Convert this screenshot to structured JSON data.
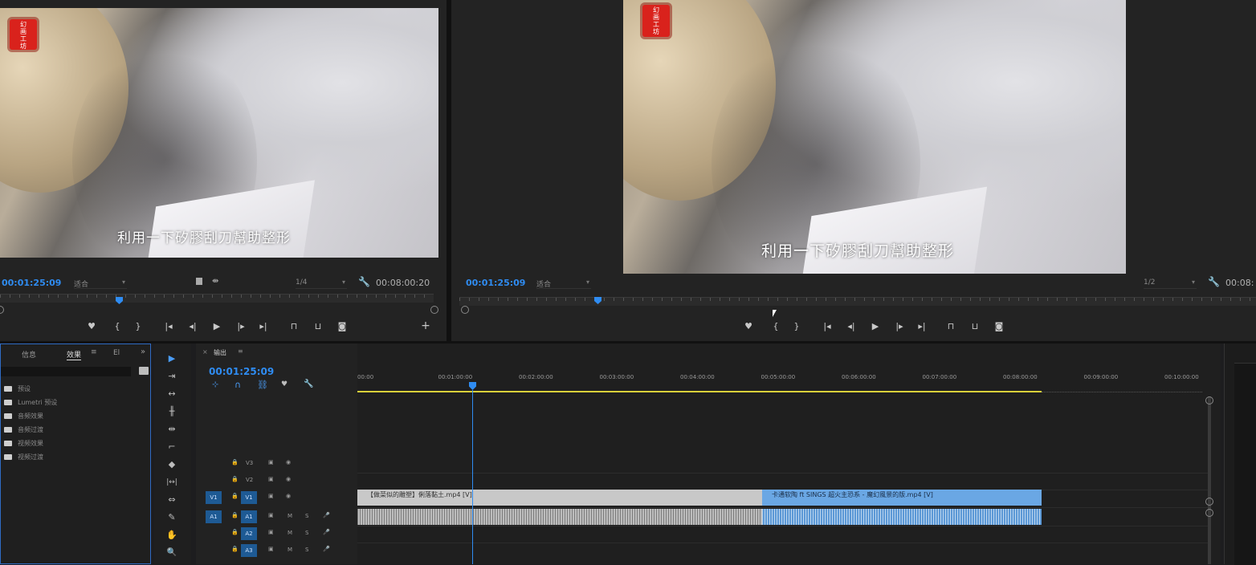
{
  "source_monitor": {
    "subtitle": "利用一下矽膠刮刀幫助整形",
    "logo_text": "幻\n画\n工\n坊",
    "timecode": "00:01:25:09",
    "fit": "适合",
    "quality": "1/4",
    "duration": "00:08:00:20",
    "playhead_fraction": 0.27
  },
  "program_monitor": {
    "subtitle": "利用一下矽膠刮刀幫助整形",
    "logo_text": "幻\n画\n工\n坊",
    "timecode": "00:01:25:09",
    "fit": "适合",
    "quality": "1/2",
    "duration": "00:08:",
    "playhead_fraction": 0.175
  },
  "transport": {
    "marker": "♥",
    "in": "{",
    "out": "}",
    "go_in": "|◂",
    "step_back": "◂|",
    "play": "▶",
    "step_fwd": "|▸",
    "go_out": "▸|",
    "lift": "⊓",
    "extract": "⊔",
    "export_frame": "◙",
    "add": "+"
  },
  "project_panel": {
    "tabs": [
      "信息",
      "效果",
      "El"
    ],
    "active_tab": "效果",
    "menu_glyph": "≡",
    "expand_glyph": "»",
    "items": [
      "预设",
      "Lumetri 预设",
      "音频效果",
      "音频过渡",
      "视频效果",
      "视频过渡"
    ]
  },
  "tools": {
    "select": "▶",
    "track_select": "⇥",
    "ripple": "↔",
    "rolling": "╫",
    "rate": "⇹",
    "razor": "◆",
    "slip": "|↔|",
    "slide": "⇔",
    "pen": "✎",
    "hand": "✋",
    "zoom": "🔍"
  },
  "timeline": {
    "sequence_name": "输出",
    "timecode": "00:01:25:09",
    "ruler": [
      "00:00",
      "00:01:00:00",
      "00:02:00:00",
      "00:03:00:00",
      "00:04:00:00",
      "00:05:00:00",
      "00:06:00:00",
      "00:07:00:00",
      "00:08:00:00",
      "00:09:00:00",
      "00:10:00:00"
    ],
    "video_tracks": [
      "V3",
      "V2",
      "V1"
    ],
    "audio_tracks": [
      "A1",
      "A2",
      "A3"
    ],
    "src_targets": {
      "video": "V1",
      "audio": "A1"
    },
    "toggles": {
      "lock": "🔒",
      "sync": "▣",
      "eye": "◉",
      "mute": "M",
      "solo": "S",
      "mic": "🎤"
    },
    "clips": {
      "v1_a": "【做菜似的雕塑】俐落黏土.mp4 [V]",
      "v1_b": "卡通软陶 ft SINGS 超火主恐系 - 魔幻風景的版.mp4 [V]"
    },
    "colors": {
      "clip_a": "#c8c8c8",
      "clip_b": "#6aa7e4",
      "playhead": "#2f8cf2",
      "work_area": "#d9d03a"
    }
  }
}
